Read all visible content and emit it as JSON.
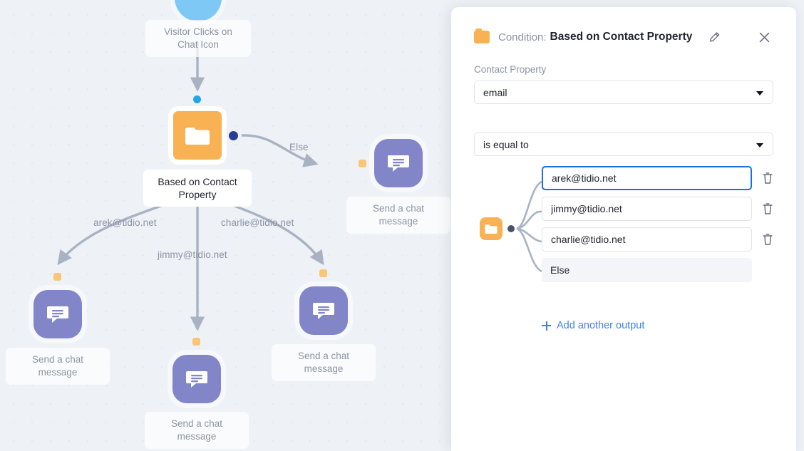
{
  "canvas": {
    "nodes": [
      {
        "id": "trigger",
        "label": "Visitor Clicks on\nChat Icon",
        "icon": "circle-trigger-icon",
        "selected": false
      },
      {
        "id": "condition",
        "label": "Based on Contact\nProperty",
        "icon": "folder-icon",
        "selected": true
      },
      {
        "id": "msg-else",
        "label": "Send a chat\nmessage",
        "icon": "chat-message-icon",
        "selected": false
      },
      {
        "id": "msg-arek",
        "label": "Send a chat\nmessage",
        "icon": "chat-message-icon",
        "selected": false
      },
      {
        "id": "msg-jimmy",
        "label": "Send a chat\nmessage",
        "icon": "chat-message-icon",
        "selected": false
      },
      {
        "id": "msg-charlie",
        "label": "Send a chat\nmessage",
        "icon": "chat-message-icon",
        "selected": false
      }
    ],
    "edge_labels": {
      "else": "Else",
      "arek": "arek@tidio.net",
      "jimmy": "jimmy@tidio.net",
      "charlie": "charlie@tidio.net"
    }
  },
  "panel": {
    "header": {
      "folder_icon": "folder-icon",
      "prefix": "Condition:",
      "title": "Based on Contact Property",
      "edit_icon": "pencil-icon",
      "close_icon": "close-icon"
    },
    "contact_property": {
      "label": "Contact Property",
      "value": "email"
    },
    "operator": {
      "value": "is equal to"
    },
    "outputs": [
      {
        "value": "arek@tidio.net",
        "focused": true,
        "deletable": true,
        "type": "input"
      },
      {
        "value": "jimmy@tidio.net",
        "focused": false,
        "deletable": true,
        "type": "input"
      },
      {
        "value": "charlie@tidio.net",
        "focused": false,
        "deletable": true,
        "type": "input"
      },
      {
        "value": "Else",
        "focused": false,
        "deletable": false,
        "type": "else"
      }
    ],
    "add_output_label": "Add another output",
    "delete_icon": "trash-icon"
  },
  "colors": {
    "canvas_bg": "#eef1f5",
    "condition_orange": "#f9b253",
    "message_purple": "#8286c9",
    "trigger_blue": "#7ec8f5",
    "output_dot_navy": "#2c3b93",
    "input_dot_orange": "#f8c675",
    "link_blue": "#3b82f6",
    "focus_border": "#1a6fe0",
    "edge_gray": "#a9b2c3"
  }
}
